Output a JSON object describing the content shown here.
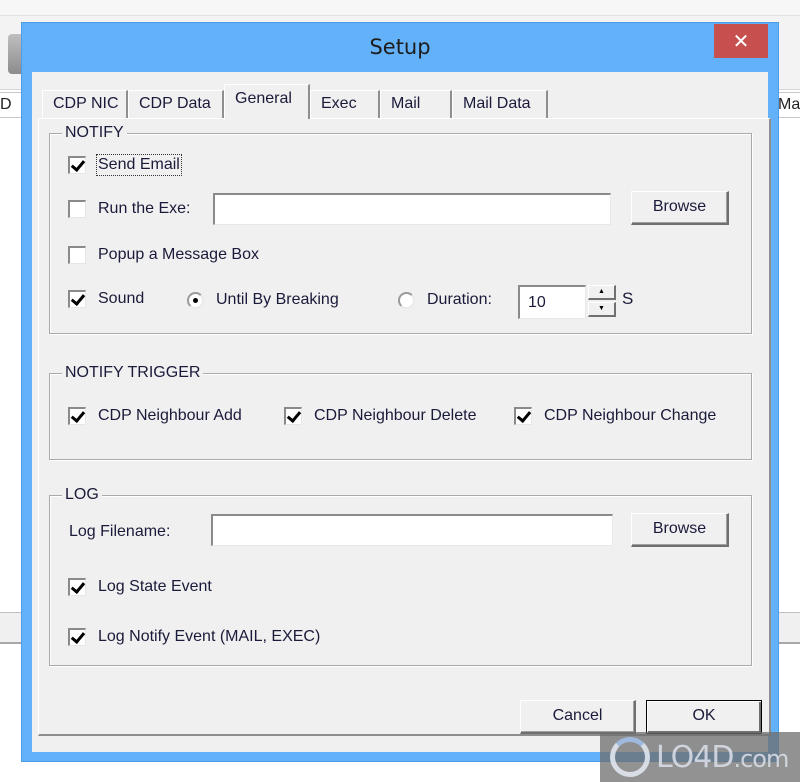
{
  "background_app": {
    "left_header_fragment": "D",
    "right_header_fragment": "Ma"
  },
  "dialog": {
    "title": "Setup",
    "close_glyph": "✕",
    "tabs": [
      {
        "label": "CDP NIC",
        "active": false
      },
      {
        "label": "CDP Data",
        "active": false
      },
      {
        "label": "General",
        "active": true
      },
      {
        "label": "Exec",
        "active": false
      },
      {
        "label": "Mail",
        "active": false
      },
      {
        "label": "Mail Data",
        "active": false
      }
    ],
    "notify": {
      "label": "NOTIFY",
      "send_email": {
        "label": "Send Email",
        "checked": true
      },
      "run_exe": {
        "label": "Run the Exe:",
        "checked": false,
        "path_value": "",
        "browse_label": "Browse"
      },
      "popup": {
        "label": "Popup a Message Box",
        "checked": false
      },
      "sound": {
        "label": "Sound",
        "checked": true
      },
      "until_breaking": {
        "label": "Until By Breaking",
        "selected": true
      },
      "duration": {
        "label": "Duration:",
        "selected": false,
        "value": "10",
        "unit": "S",
        "up_glyph": "▲",
        "down_glyph": "▼"
      }
    },
    "notify_trigger": {
      "label": "NOTIFY TRIGGER",
      "items": [
        {
          "label": "CDP Neighbour Add",
          "checked": true
        },
        {
          "label": "CDP Neighbour Delete",
          "checked": true
        },
        {
          "label": "CDP Neighbour Change",
          "checked": true
        }
      ]
    },
    "log": {
      "label": "LOG",
      "filename_label": "Log Filename:",
      "filename_value": "",
      "browse_label": "Browse",
      "state_event": {
        "label": "Log State Event",
        "checked": true
      },
      "notify_event": {
        "label": "Log Notify Event (MAIL, EXEC)",
        "checked": true
      }
    },
    "buttons": {
      "cancel": "Cancel",
      "ok": "OK"
    }
  },
  "watermark": {
    "brand": "LO4D",
    "suffix": ".com"
  }
}
